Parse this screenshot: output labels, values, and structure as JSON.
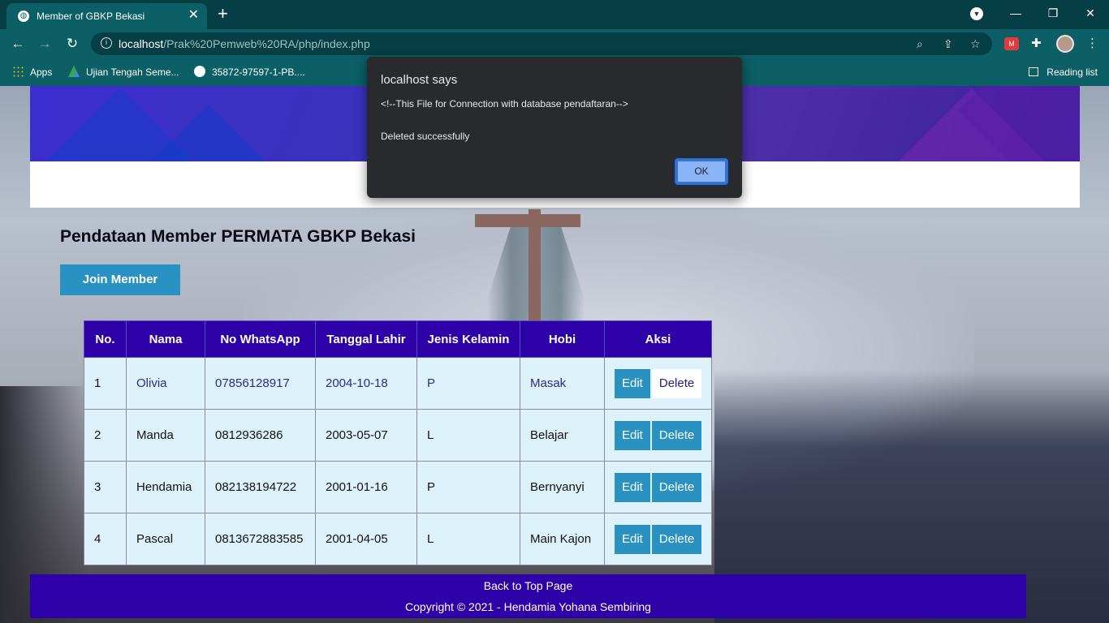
{
  "browser": {
    "tab_title": "Member of GBKP Bekasi",
    "tab_close": "✕",
    "new_tab": "+",
    "url_host": "localhost",
    "url_path": "/Prak%20Pemweb%20RA/php/index.php",
    "bookmarks": [
      {
        "label": "Apps",
        "icon": "apps-icon"
      },
      {
        "label": "Ujian Tengah Seme...",
        "icon": "google-drive-icon"
      },
      {
        "label": "35872-97597-1-PB....",
        "icon": "globe-icon"
      }
    ],
    "reading_list": "Reading list"
  },
  "dialog": {
    "heading": "localhost says",
    "message_line1": "<!--This File for Connection with database pendaftaran-->",
    "message_line2": "Deleted successfully",
    "ok_label": "OK"
  },
  "page": {
    "title": "Pendataan Member PERMATA GBKP Bekasi",
    "join_button": "Join Member",
    "table": {
      "headers": [
        "No.",
        "Nama",
        "No WhatsApp",
        "Tanggal Lahir",
        "Jenis Kelamin",
        "Hobi",
        "Aksi"
      ],
      "edit_label": "Edit",
      "delete_label": "Delete",
      "rows": [
        {
          "no": "1",
          "nama": "Olivia",
          "wa": "07856128917",
          "lahir": "2004-10-18",
          "jk": "P",
          "hobi": "Masak"
        },
        {
          "no": "2",
          "nama": "Manda",
          "wa": "0812936286",
          "lahir": "2003-05-07",
          "jk": "L",
          "hobi": "Belajar"
        },
        {
          "no": "3",
          "nama": "Hendamia",
          "wa": "082138194722",
          "lahir": "2001-01-16",
          "jk": "P",
          "hobi": "Bernyanyi"
        },
        {
          "no": "4",
          "nama": "Pascal",
          "wa": "0813672883585",
          "lahir": "2001-04-05",
          "jk": "L",
          "hobi": "Main Kajon"
        }
      ]
    },
    "footer": {
      "back_to_top": "Back to Top Page",
      "copyright": "Copyright © 2021 - Hendamia Yohana Sembiring"
    }
  },
  "colors": {
    "header_purple": "#2e00a8",
    "button_blue": "#2a92c2",
    "table_cell": "#ddf2fb",
    "chrome_teal": "#0b5f65"
  }
}
